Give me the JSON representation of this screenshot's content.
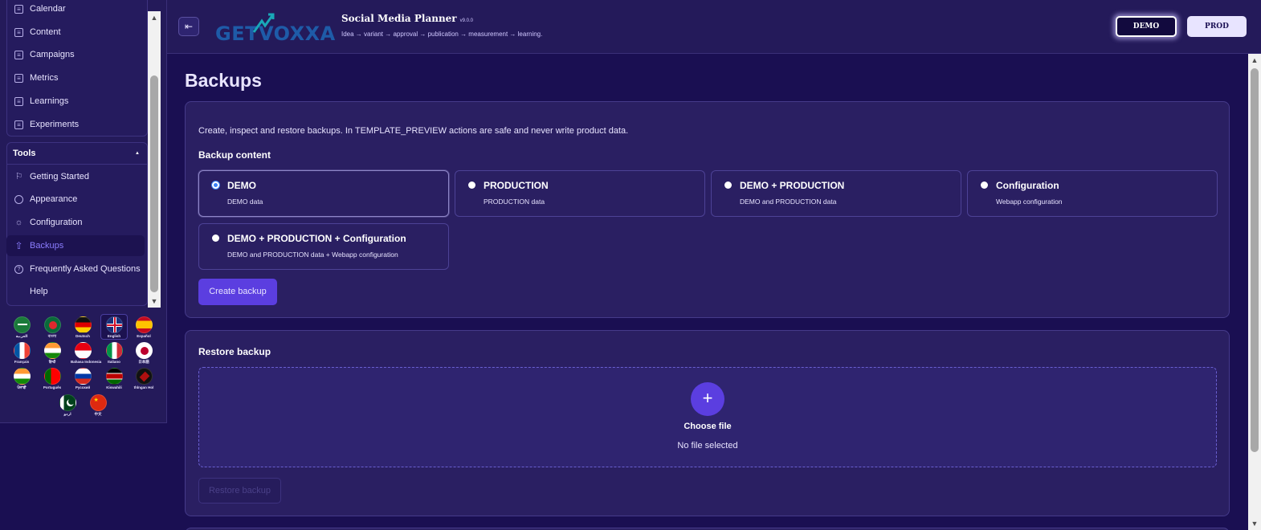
{
  "sidebar": {
    "partial_item": "Calendar",
    "items": [
      {
        "label": "Content",
        "icon": "document-icon"
      },
      {
        "label": "Campaigns",
        "icon": "document-icon"
      },
      {
        "label": "Metrics",
        "icon": "document-icon"
      },
      {
        "label": "Learnings",
        "icon": "document-icon"
      },
      {
        "label": "Experiments",
        "icon": "document-icon"
      }
    ],
    "tools": {
      "label": "Tools",
      "toggle": "▲",
      "items": [
        {
          "label": "Getting Started",
          "icon": "flag-icon"
        },
        {
          "label": "Appearance",
          "icon": "palette-icon"
        },
        {
          "label": "Configuration",
          "icon": "gear-icon"
        },
        {
          "label": "Backups",
          "icon": "upload-icon",
          "active": true
        },
        {
          "label": "Frequently Asked Questions",
          "icon": "help-circle-icon"
        },
        {
          "label": "Help",
          "icon": ""
        }
      ]
    },
    "languages": [
      {
        "label": "العربية"
      },
      {
        "label": "বাংলা"
      },
      {
        "label": "Deutsch"
      },
      {
        "label": "English"
      },
      {
        "label": "Español"
      },
      {
        "label": "Français"
      },
      {
        "label": "हिन्दी"
      },
      {
        "label": "Bahasa Indonesia"
      },
      {
        "label": "Italiano"
      },
      {
        "label": "日本語"
      },
      {
        "label": "ਪੰਜਾਬੀ"
      },
      {
        "label": "Português"
      },
      {
        "label": "Русский"
      },
      {
        "label": "Kiswahili"
      },
      {
        "label": "thlngan Hol"
      },
      {
        "label": "اردو"
      },
      {
        "label": "中文"
      }
    ]
  },
  "header": {
    "logo": "GETVOXXA",
    "title": "Social Media Planner",
    "version": "v9.0.0",
    "subtitle": "Idea → variant → approval → publication → measurement → learning.",
    "env_demo": "DEMO",
    "env_prod": "PROD"
  },
  "page": {
    "title": "Backups",
    "description": "Create, inspect and restore backups. In TEMPLATE_PREVIEW actions are safe and never write product data.",
    "backup_content_label": "Backup content",
    "options": [
      {
        "title": "DEMO",
        "sub": "DEMO data",
        "selected": true
      },
      {
        "title": "PRODUCTION",
        "sub": "PRODUCTION data",
        "selected": false
      },
      {
        "title": "DEMO + PRODUCTION",
        "sub": "DEMO and PRODUCTION data",
        "selected": false
      },
      {
        "title": "Configuration",
        "sub": "Webapp configuration",
        "selected": false
      },
      {
        "title": "DEMO + PRODUCTION + Configuration",
        "sub": "DEMO and PRODUCTION data + Webapp configuration",
        "selected": false
      }
    ],
    "create_button": "Create backup",
    "restore_title": "Restore backup",
    "plus": "+",
    "choose_file": "Choose file",
    "no_file": "No file selected",
    "restore_button": "Restore backup"
  },
  "colors": {
    "background": "#1a0f52",
    "panel": "#2a1f62",
    "accent": "#5b3ee0",
    "active_text": "#8b7dff"
  }
}
